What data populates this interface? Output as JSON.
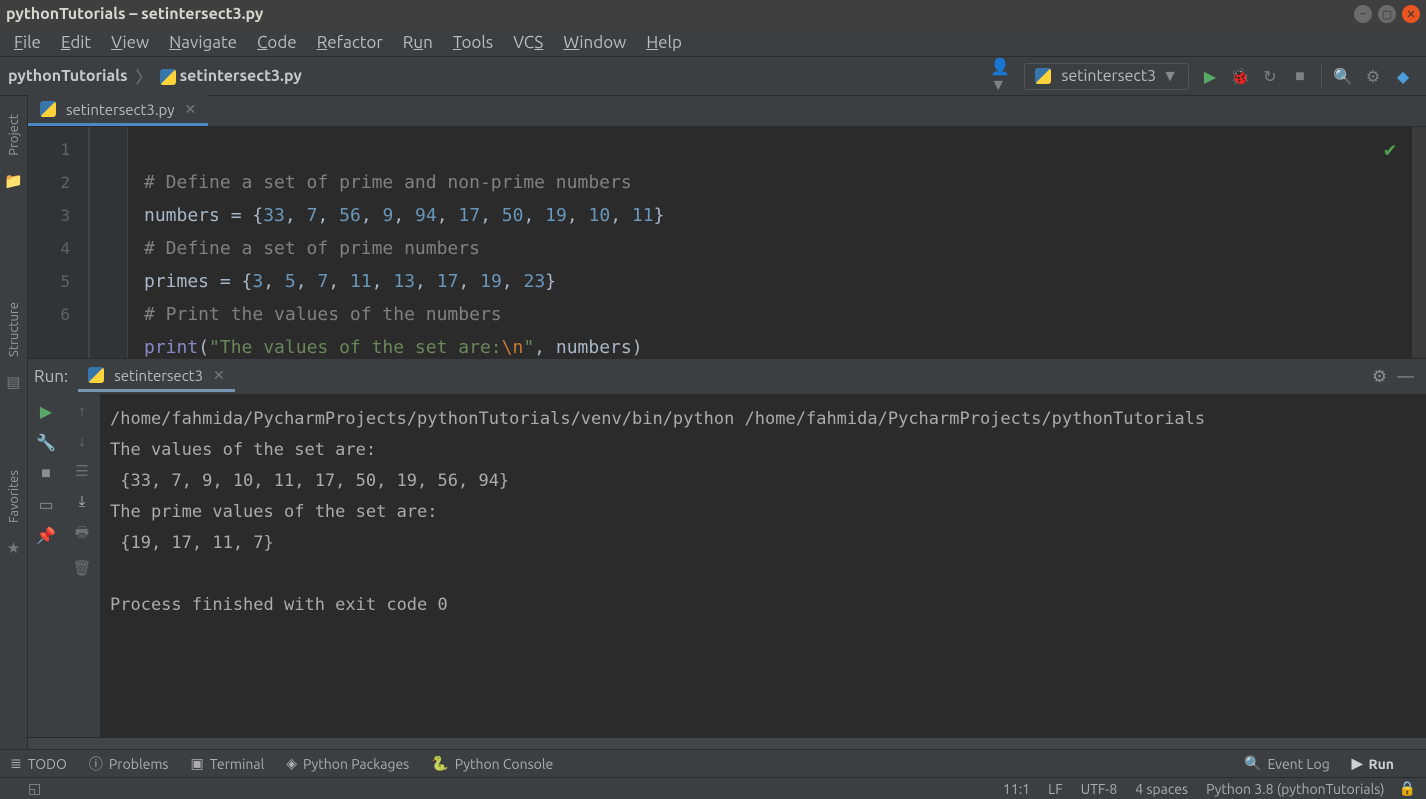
{
  "window": {
    "title": "pythonTutorials – setintersect3.py"
  },
  "menu": [
    "File",
    "Edit",
    "View",
    "Navigate",
    "Code",
    "Refactor",
    "Run",
    "Tools",
    "VCS",
    "Window",
    "Help"
  ],
  "breadcrumb": {
    "project": "pythonTutorials",
    "file": "setintersect3.py"
  },
  "runconfig": "setintersect3",
  "editorTab": "setintersect3.py",
  "gutter": [
    "1",
    "2",
    "3",
    "4",
    "5",
    "6"
  ],
  "code": {
    "l1": "# Define a set of prime and non-prime numbers",
    "l2a": "numbers",
    "l2b": " = {",
    "l2n": [
      "33",
      "7",
      "56",
      "9",
      "94",
      "17",
      "50",
      "19",
      "10",
      "11"
    ],
    "l2c": "}",
    "l3": "# Define a set of prime numbers",
    "l4a": "primes",
    "l4b": " = {",
    "l4n": [
      "3",
      "5",
      "7",
      "11",
      "13",
      "17",
      "19",
      "23"
    ],
    "l4c": "}",
    "l5": "# Print the values of the numbers",
    "l6fn": "print",
    "l6a": "(",
    "l6s1": "\"The values of the set are:",
    "l6esc": "\\n",
    "l6s2": "\"",
    "l6c": ", ",
    "l6id": "numbers",
    "l6b": ")"
  },
  "run": {
    "label": "Run:",
    "tab": "setintersect3",
    "cmd": "/home/fahmida/PycharmProjects/pythonTutorials/venv/bin/python /home/fahmida/PycharmProjects/pythonTutorials",
    "l1": "The values of the set are:",
    "l2": " {33, 7, 9, 10, 11, 17, 50, 19, 56, 94}",
    "l3": "The prime values of the set are:",
    "l4": " {19, 17, 11, 7}",
    "l5": "",
    "l6": "Process finished with exit code 0"
  },
  "bottom": {
    "todo": "TODO",
    "problems": "Problems",
    "terminal": "Terminal",
    "pkgs": "Python Packages",
    "pyconsole": "Python Console",
    "eventlog": "Event Log",
    "run": "Run"
  },
  "left": {
    "project": "Project",
    "structure": "Structure",
    "favorites": "Favorites"
  },
  "status": {
    "pos": "11:1",
    "lf": "LF",
    "enc": "UTF-8",
    "indent": "4 spaces",
    "sdk": "Python 3.8 (pythonTutorials)"
  }
}
